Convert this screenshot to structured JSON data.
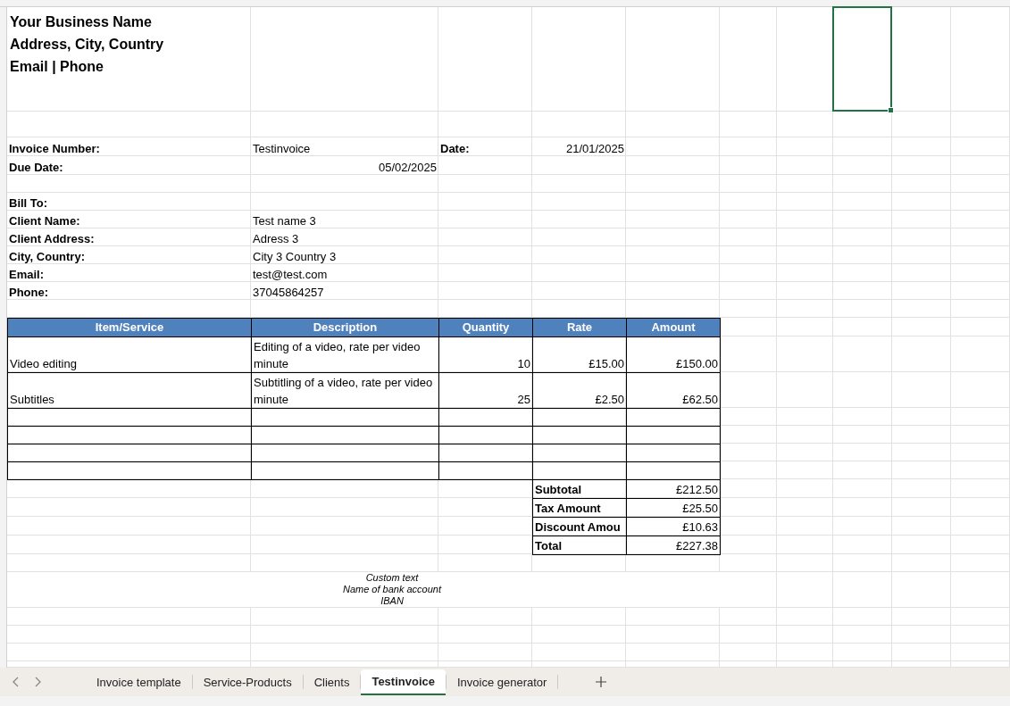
{
  "business": {
    "lines": [
      "Your Business Name",
      "Address, City, Country",
      "Email | Phone"
    ]
  },
  "invoice_number": {
    "label": "Invoice Number:",
    "value": "Testinvoice"
  },
  "date": {
    "label": "Date:",
    "value": "21/01/2025"
  },
  "due_date": {
    "label": "Due Date:",
    "value": "05/02/2025"
  },
  "bill_to": {
    "title": "Bill To:",
    "fields": [
      {
        "label": "Client Name:",
        "value": "Test name 3"
      },
      {
        "label": "Client Address:",
        "value": "Adress 3"
      },
      {
        "label": "City, Country:",
        "value": "City 3 Country 3"
      },
      {
        "label": "Email:",
        "value": "test@test.com"
      },
      {
        "label": "Phone:",
        "value": "37045864257"
      }
    ]
  },
  "table": {
    "columns": [
      "Item/Service",
      "Description",
      "Quantity",
      "Rate",
      "Amount"
    ],
    "rows": [
      [
        "Video editing",
        "Editing of a video, rate per video minute",
        "10",
        "£15.00",
        "£150.00"
      ],
      [
        "Subtitles",
        "Subtitling of a video, rate per video minute",
        "25",
        "£2.50",
        "£62.50"
      ]
    ]
  },
  "totals": [
    {
      "label": "Subtotal",
      "value": "£212.50"
    },
    {
      "label": "Tax Amount",
      "value": "£25.50"
    },
    {
      "label": "Discount Amou",
      "value": "£10.63"
    },
    {
      "label": "Total",
      "value": "£227.38"
    }
  ],
  "footer": {
    "lines": [
      "Custom text",
      "Name of bank account",
      "IBAN"
    ]
  },
  "sheet_tabs": [
    {
      "label": "Invoice template",
      "selected": false
    },
    {
      "label": "Service-Products",
      "selected": false
    },
    {
      "label": "Clients",
      "selected": false
    },
    {
      "label": "Testinvoice",
      "selected": true
    },
    {
      "label": "Invoice generator",
      "selected": false
    }
  ]
}
